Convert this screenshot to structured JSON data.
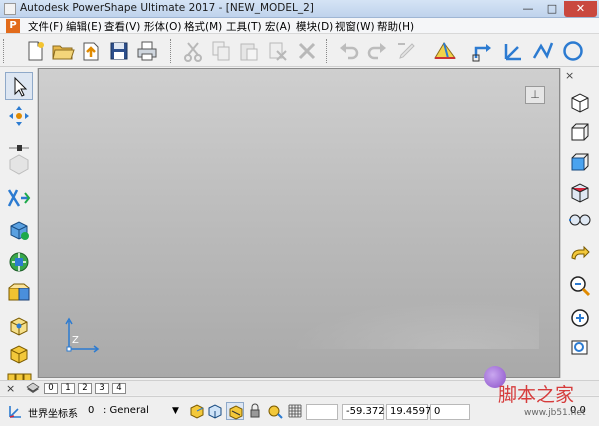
{
  "window": {
    "title": "Autodesk PowerShape Ultimate 2017 - [NEW_MODEL_2]",
    "controls": {
      "minimize": "—",
      "maximize": "□",
      "close": "✕"
    }
  },
  "menu": {
    "items": [
      "文件(F)",
      "编辑(E)",
      "查看(V)",
      "形体(O)",
      "格式(M)",
      "工具(T)",
      "宏(A)",
      "模块(D)",
      "视窗(W)",
      "帮助(H)"
    ]
  },
  "toolbar": {
    "icons": [
      "pin-icon",
      "new-file-icon",
      "open-folder-icon",
      "import-icon",
      "save-icon",
      "print-icon",
      "cut-icon",
      "copy-icon",
      "paste-icon",
      "delete-icon",
      "undo-icon",
      "redo-icon",
      "edit-disabled-icon",
      "surface-view-icon",
      "workplane-icon",
      "axis-icon",
      "line-icon",
      "circle-icon"
    ]
  },
  "viewport": {
    "view_toggle_symbol": "⊥",
    "axis_label": "Z"
  },
  "left_toolbar": {
    "icons": [
      "select-arrow-icon",
      "transform-icon",
      "pin-icon",
      "solid-disabled-icon",
      "curve-icon",
      "cube-blue-icon",
      "cube-green-icon",
      "cube-yellow-blue-icon",
      "cube-wire-icon",
      "cube-yellow-icon",
      "cube-multi-icon"
    ]
  },
  "right_toolbar": {
    "close_symbol": "×",
    "icons": [
      "iso-cube-icon",
      "wire-cube-icon",
      "front-cube-icon",
      "red-cube-icon",
      "camera-icon",
      "hand-pan-icon",
      "zoom-icon",
      "zoom-fit-icon",
      "zoom-box-icon"
    ]
  },
  "levels": {
    "close_symbol": "×",
    "tabs": [
      "0",
      "1",
      "2",
      "3",
      "4"
    ]
  },
  "statusbar": {
    "coord_system": "世界坐标系",
    "layer_number": "0",
    "layer_name": ": General",
    "x_value": "-59.372",
    "y_value": "19.4597",
    "z_value": "0",
    "extra_value": "0.0"
  },
  "watermark": {
    "text": "脚本之家",
    "url": "www.jb51.net"
  },
  "colors": {
    "accent_blue": "#2c7bd1",
    "close_red": "#c9483f",
    "logo_orange": "#e26b1b"
  }
}
